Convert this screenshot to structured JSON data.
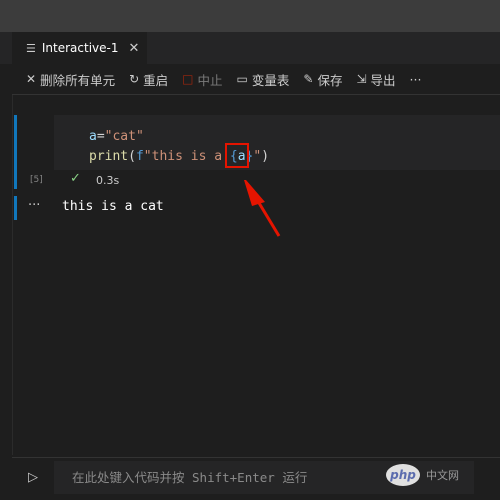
{
  "tab": {
    "title": "Interactive-1",
    "close_glyph": "✕"
  },
  "toolbar": {
    "clear_all": "删除所有单元",
    "restart": "重启",
    "interrupt": "中止",
    "variables": "变量表",
    "save": "保存",
    "export": "导出",
    "more": "···"
  },
  "cell": {
    "execution_count": "[5]",
    "code_line1": {
      "var": "a",
      "eq": "=",
      "str": "\"cat\""
    },
    "code_line2": {
      "func": "print",
      "open": "(",
      "fprefix": "f",
      "fstr_start": "\"this is a ",
      "brace_open": "{",
      "inner_var": "a",
      "brace_close": "}",
      "fstr_end": "\"",
      "close": ")"
    },
    "status_glyph": "✓",
    "duration": "0.3s"
  },
  "output": {
    "dots": "···",
    "text": "this is a cat"
  },
  "input": {
    "placeholder": "在此处键入代码并按 Shift+Enter 运行"
  },
  "watermark": {
    "logo": "php",
    "text": "中文网"
  },
  "colors": {
    "accent": "#1177bb",
    "highlight_box": "#e51400",
    "success": "#89d185"
  }
}
